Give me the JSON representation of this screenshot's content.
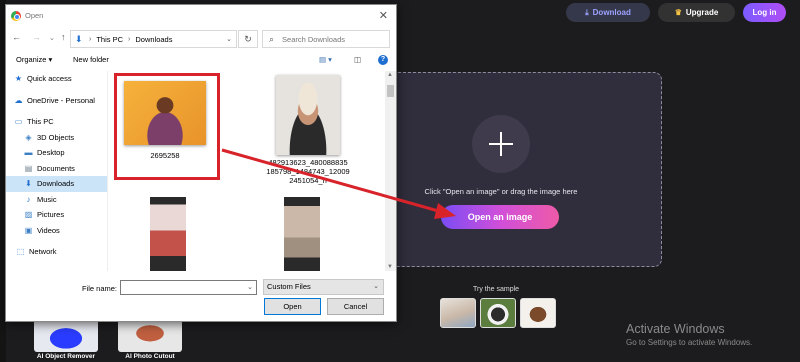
{
  "header": {
    "download_label": "Download",
    "upgrade_label": "Upgrade",
    "login_label": "Log in"
  },
  "uploader": {
    "hint": "Click \"Open an image\" or drag the image here",
    "open_label": "Open an image",
    "try_sample": "Try the sample"
  },
  "tools": [
    {
      "label": "AI Object Remover"
    },
    {
      "label": "AI Photo Cutout"
    }
  ],
  "watermark": {
    "line1": "Activate Windows",
    "line2": "Go to Settings to activate Windows."
  },
  "dialog": {
    "title": "Open",
    "breadcrumb": [
      "This PC",
      "Downloads"
    ],
    "search_placeholder": "Search Downloads",
    "toolbar": {
      "organize": "Organize",
      "new_folder": "New folder"
    },
    "sidebar": [
      {
        "label": "Quick access",
        "icon": "star-icon"
      },
      {
        "label": "OneDrive - Personal",
        "icon": "cloud-icon"
      },
      {
        "label": "This PC",
        "icon": "computer-icon"
      },
      {
        "label": "3D Objects",
        "icon": "cube-icon"
      },
      {
        "label": "Desktop",
        "icon": "desktop-icon"
      },
      {
        "label": "Documents",
        "icon": "document-icon"
      },
      {
        "label": "Downloads",
        "icon": "download-icon",
        "selected": true
      },
      {
        "label": "Music",
        "icon": "music-icon"
      },
      {
        "label": "Pictures",
        "icon": "picture-icon"
      },
      {
        "label": "Videos",
        "icon": "video-icon"
      },
      {
        "label": "Network",
        "icon": "network-icon"
      }
    ],
    "files": [
      {
        "name": "2695258"
      },
      {
        "name_lines": [
          "482913623_480088835",
          "185798_1484743_12009",
          "2451054_n"
        ]
      },
      {
        "name": ""
      },
      {
        "name": ""
      }
    ],
    "file_name_label": "File name:",
    "file_name_value": "",
    "file_type": "Custom Files",
    "open_button": "Open",
    "cancel_button": "Cancel"
  },
  "colors": {
    "selection_highlight": "#cce4f7",
    "annotation_red": "#d8232a",
    "brand_gradient_start": "#7a4cf5",
    "brand_gradient_end": "#ee5aa8"
  }
}
